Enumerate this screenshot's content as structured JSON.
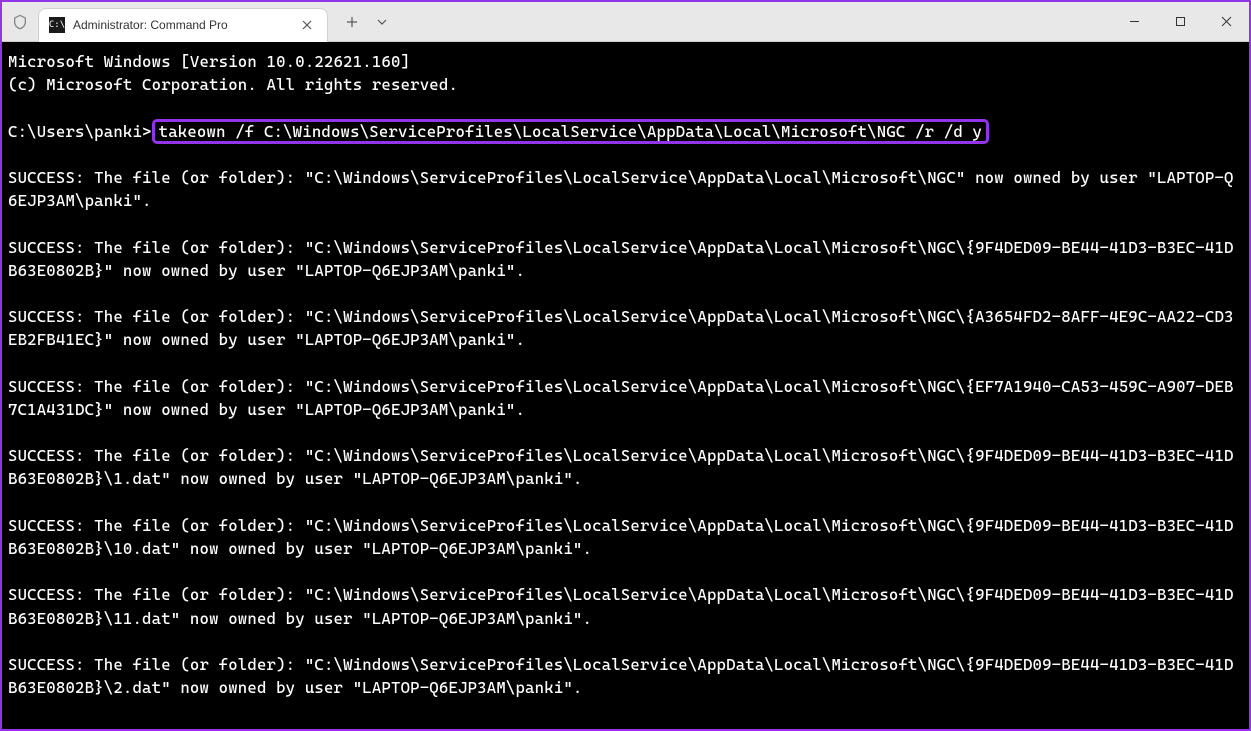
{
  "window": {
    "tab_title": "Administrator: Command Pro",
    "tab_icon_text": "C:\\"
  },
  "terminal": {
    "header_line1": "Microsoft Windows [Version 10.0.22621.160]",
    "header_line2": "(c) Microsoft Corporation. All rights reserved.",
    "prompt_prefix": "C:\\Users\\panki>",
    "command": "takeown /f C:\\Windows\\ServiceProfiles\\LocalService\\AppData\\Local\\Microsoft\\NGC /r /d y",
    "output_lines": [
      "SUCCESS: The file (or folder): \"C:\\Windows\\ServiceProfiles\\LocalService\\AppData\\Local\\Microsoft\\NGC\" now owned by user \"LAPTOP-Q6EJP3AM\\panki\".",
      "",
      "SUCCESS: The file (or folder): \"C:\\Windows\\ServiceProfiles\\LocalService\\AppData\\Local\\Microsoft\\NGC\\{9F4DED09-BE44-41D3-B3EC-41DB63E0802B}\" now owned by user \"LAPTOP-Q6EJP3AM\\panki\".",
      "",
      "SUCCESS: The file (or folder): \"C:\\Windows\\ServiceProfiles\\LocalService\\AppData\\Local\\Microsoft\\NGC\\{A3654FD2-8AFF-4E9C-AA22-CD3EB2FB41EC}\" now owned by user \"LAPTOP-Q6EJP3AM\\panki\".",
      "",
      "SUCCESS: The file (or folder): \"C:\\Windows\\ServiceProfiles\\LocalService\\AppData\\Local\\Microsoft\\NGC\\{EF7A1940-CA53-459C-A907-DEB7C1A431DC}\" now owned by user \"LAPTOP-Q6EJP3AM\\panki\".",
      "",
      "SUCCESS: The file (or folder): \"C:\\Windows\\ServiceProfiles\\LocalService\\AppData\\Local\\Microsoft\\NGC\\{9F4DED09-BE44-41D3-B3EC-41DB63E0802B}\\1.dat\" now owned by user \"LAPTOP-Q6EJP3AM\\panki\".",
      "",
      "SUCCESS: The file (or folder): \"C:\\Windows\\ServiceProfiles\\LocalService\\AppData\\Local\\Microsoft\\NGC\\{9F4DED09-BE44-41D3-B3EC-41DB63E0802B}\\10.dat\" now owned by user \"LAPTOP-Q6EJP3AM\\panki\".",
      "",
      "SUCCESS: The file (or folder): \"C:\\Windows\\ServiceProfiles\\LocalService\\AppData\\Local\\Microsoft\\NGC\\{9F4DED09-BE44-41D3-B3EC-41DB63E0802B}\\11.dat\" now owned by user \"LAPTOP-Q6EJP3AM\\panki\".",
      "",
      "SUCCESS: The file (or folder): \"C:\\Windows\\ServiceProfiles\\LocalService\\AppData\\Local\\Microsoft\\NGC\\{9F4DED09-BE44-41D3-B3EC-41DB63E0802B}\\2.dat\" now owned by user \"LAPTOP-Q6EJP3AM\\panki\"."
    ]
  }
}
